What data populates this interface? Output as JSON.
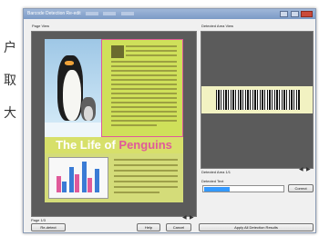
{
  "side_chars": [
    "户",
    "取",
    "大"
  ],
  "window": {
    "title": "Barcode Detection Re-edit",
    "controls": [
      "minimize",
      "maximize",
      "close"
    ]
  },
  "page_view": {
    "label": "Page View",
    "status": "Page 1/3",
    "magazine_title_main": "The Life of",
    "magazine_title_accent": "Penguins"
  },
  "detected_area_view": {
    "label": "Detected Area View",
    "detected_area_label": "Detected Area 1/1",
    "detected_text_label": "Detected Text",
    "correct_button": "Correct"
  },
  "buttons": {
    "re_detect": "Re-detect",
    "help": "Help",
    "cancel": "Cancel",
    "apply": "Apply All Detection Results"
  },
  "colors": {
    "accent": "#e05a9a",
    "page_bg": "#cfe05a",
    "selection": "#3399ff"
  }
}
